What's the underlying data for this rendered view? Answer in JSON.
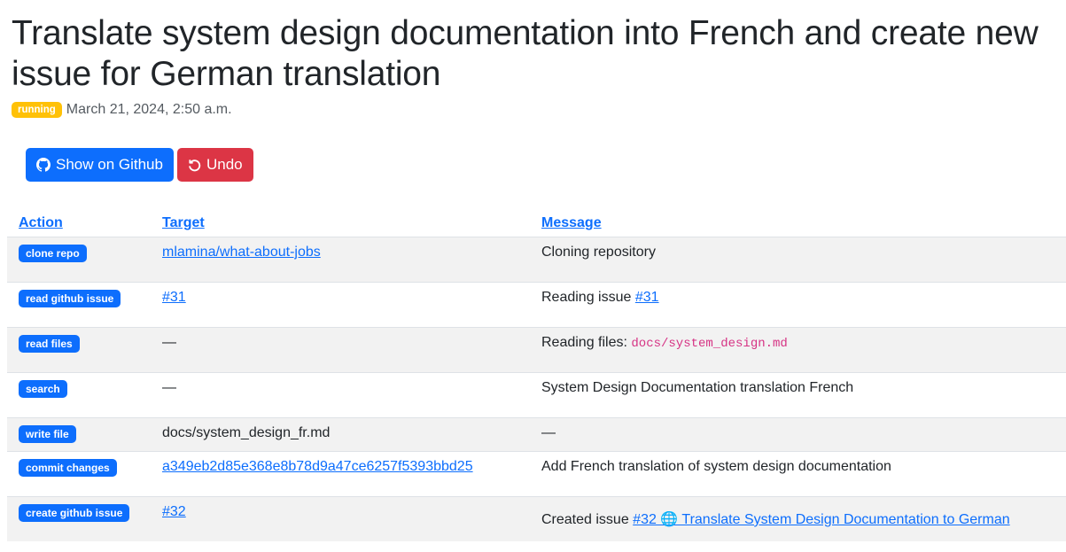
{
  "title": "Translate system design documentation into French and create new issue for German translation",
  "status_badge": "running",
  "timestamp": "March 21, 2024, 2:50 a.m.",
  "colors": {
    "primary": "#0d6efd",
    "danger": "#dc3545",
    "warning": "#ffc107"
  },
  "buttons": {
    "github": "Show on Github",
    "undo": "Undo"
  },
  "table": {
    "headers": [
      "Action",
      "Target",
      "Message"
    ],
    "rows": [
      {
        "action": "clone repo",
        "target": "mlamina/what-about-jobs",
        "message": "Cloning repository"
      },
      {
        "action": "read github issue",
        "target": "#31",
        "message_prefix": "Reading issue ",
        "message_link": "#31"
      },
      {
        "action": "read files",
        "target": "—",
        "message_prefix": "Reading files: ",
        "message_code": "docs/system_design.md"
      },
      {
        "action": "search",
        "target": "—",
        "message": "System Design Documentation translation French"
      },
      {
        "action": "write file",
        "target": "docs/system_design_fr.md",
        "message": "—"
      },
      {
        "action": "commit changes",
        "target": "a349eb2d85e368e8b78d9a47ce6257f5393bbd25",
        "message": "Add French translation of system design documentation"
      },
      {
        "action": "create github issue",
        "target": "#32",
        "message_prefix": "Created issue ",
        "message_link": "#32 🌐 Translate System Design Documentation to German"
      }
    ]
  }
}
